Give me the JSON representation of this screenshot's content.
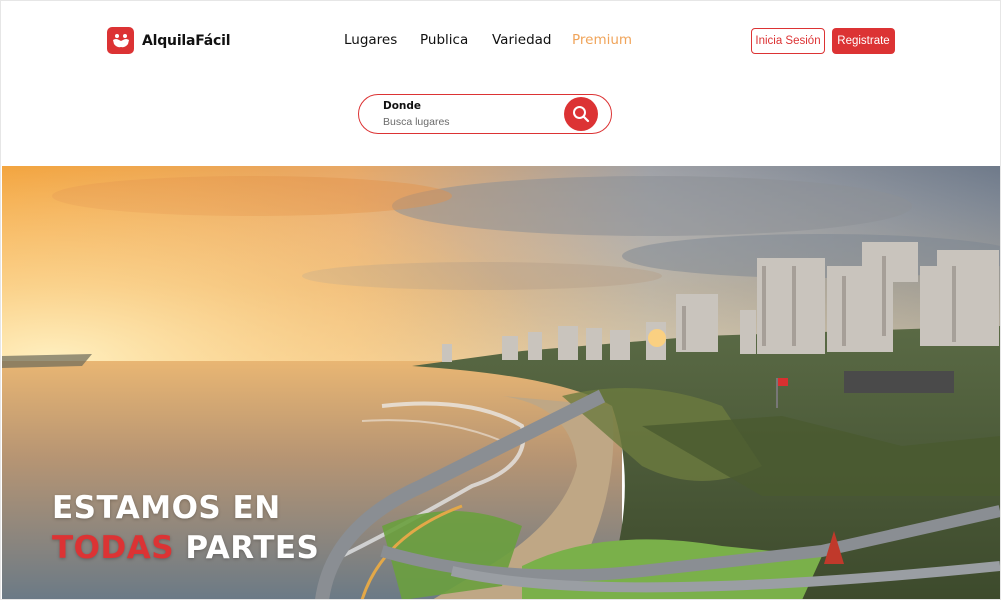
{
  "brand": {
    "name": "AlquilaFácil",
    "logo_icon": "handshake-icon"
  },
  "nav": {
    "items": [
      "Lugares",
      "Publica",
      "Variedad",
      "Premium"
    ],
    "highlight_color": "#f0a45a"
  },
  "auth": {
    "login_label": "Inicia Sesión",
    "signup_label": "Registrate"
  },
  "search": {
    "label": "Donde",
    "placeholder": "Busca lugares",
    "button_icon": "search-icon"
  },
  "hero": {
    "title_line1": "ESTAMOS EN",
    "title_line2_accent": "TODAS",
    "title_line2_rest": " PARTES"
  },
  "colors": {
    "accent": "#dc3334",
    "premium": "#f0a45a",
    "text": "#111111"
  }
}
